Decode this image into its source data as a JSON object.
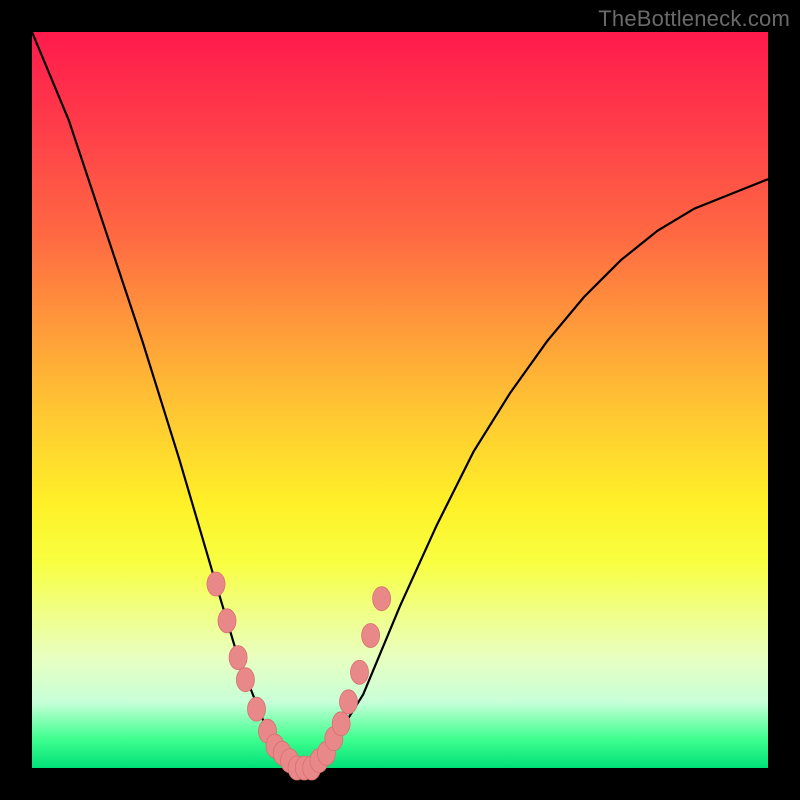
{
  "watermark": "TheBottleneck.com",
  "colors": {
    "background": "#000000",
    "gradient_top": "#ff1a4c",
    "gradient_bottom": "#00e078",
    "curve": "#000000",
    "marker_fill": "#e98888"
  },
  "chart_data": {
    "type": "line",
    "title": "",
    "xlabel": "",
    "ylabel": "",
    "xlim": [
      0,
      100
    ],
    "ylim": [
      0,
      100
    ],
    "grid": false,
    "legend_position": "none",
    "series": [
      {
        "name": "bottleneck-curve",
        "x": [
          0,
          5,
          10,
          15,
          20,
          25,
          28,
          30,
          32,
          34,
          36,
          38,
          40,
          45,
          50,
          55,
          60,
          65,
          70,
          75,
          80,
          85,
          90,
          95,
          100
        ],
        "y": [
          100,
          88,
          73,
          58,
          42,
          25,
          15,
          10,
          5,
          2,
          0,
          0,
          2,
          10,
          22,
          33,
          43,
          51,
          58,
          64,
          69,
          73,
          76,
          78,
          80
        ]
      }
    ],
    "markers": {
      "name": "highlighted-points",
      "x": [
        25,
        26.5,
        28,
        29,
        30.5,
        32,
        33,
        34,
        35,
        36,
        37,
        38,
        39,
        40,
        41,
        42,
        43,
        44.5,
        46,
        47.5
      ],
      "y": [
        25,
        20,
        15,
        12,
        8,
        5,
        3,
        2,
        1,
        0,
        0,
        0,
        1,
        2,
        4,
        6,
        9,
        13,
        18,
        23
      ]
    }
  }
}
